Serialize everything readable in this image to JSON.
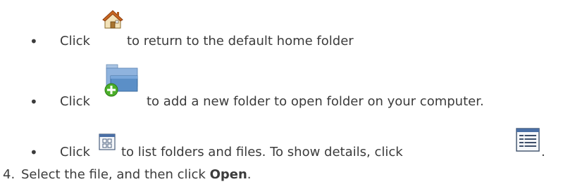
{
  "bullets": [
    {
      "bullet": "•",
      "pre": "Click",
      "icon": "home-folder-icon",
      "post": "to return to the default home folder"
    },
    {
      "bullet": "•",
      "pre": "Click",
      "icon": "new-folder-icon",
      "post": "to add a new folder to open folder on your computer."
    },
    {
      "bullet": "•",
      "pre": "Click",
      "icon": "list-view-icon",
      "mid": "to list folders and files. To show details, click",
      "icon2": "details-view-icon",
      "post": "."
    }
  ],
  "step4": {
    "number": "4.",
    "text_before": "Select the file, and then click",
    "bold": "Open",
    "text_after": "."
  },
  "colors": {
    "text": "#3b3b3b",
    "house_roof": "#c8651f",
    "folder_blue": "#5b8fc7",
    "plus_green": "#4caf2a"
  }
}
